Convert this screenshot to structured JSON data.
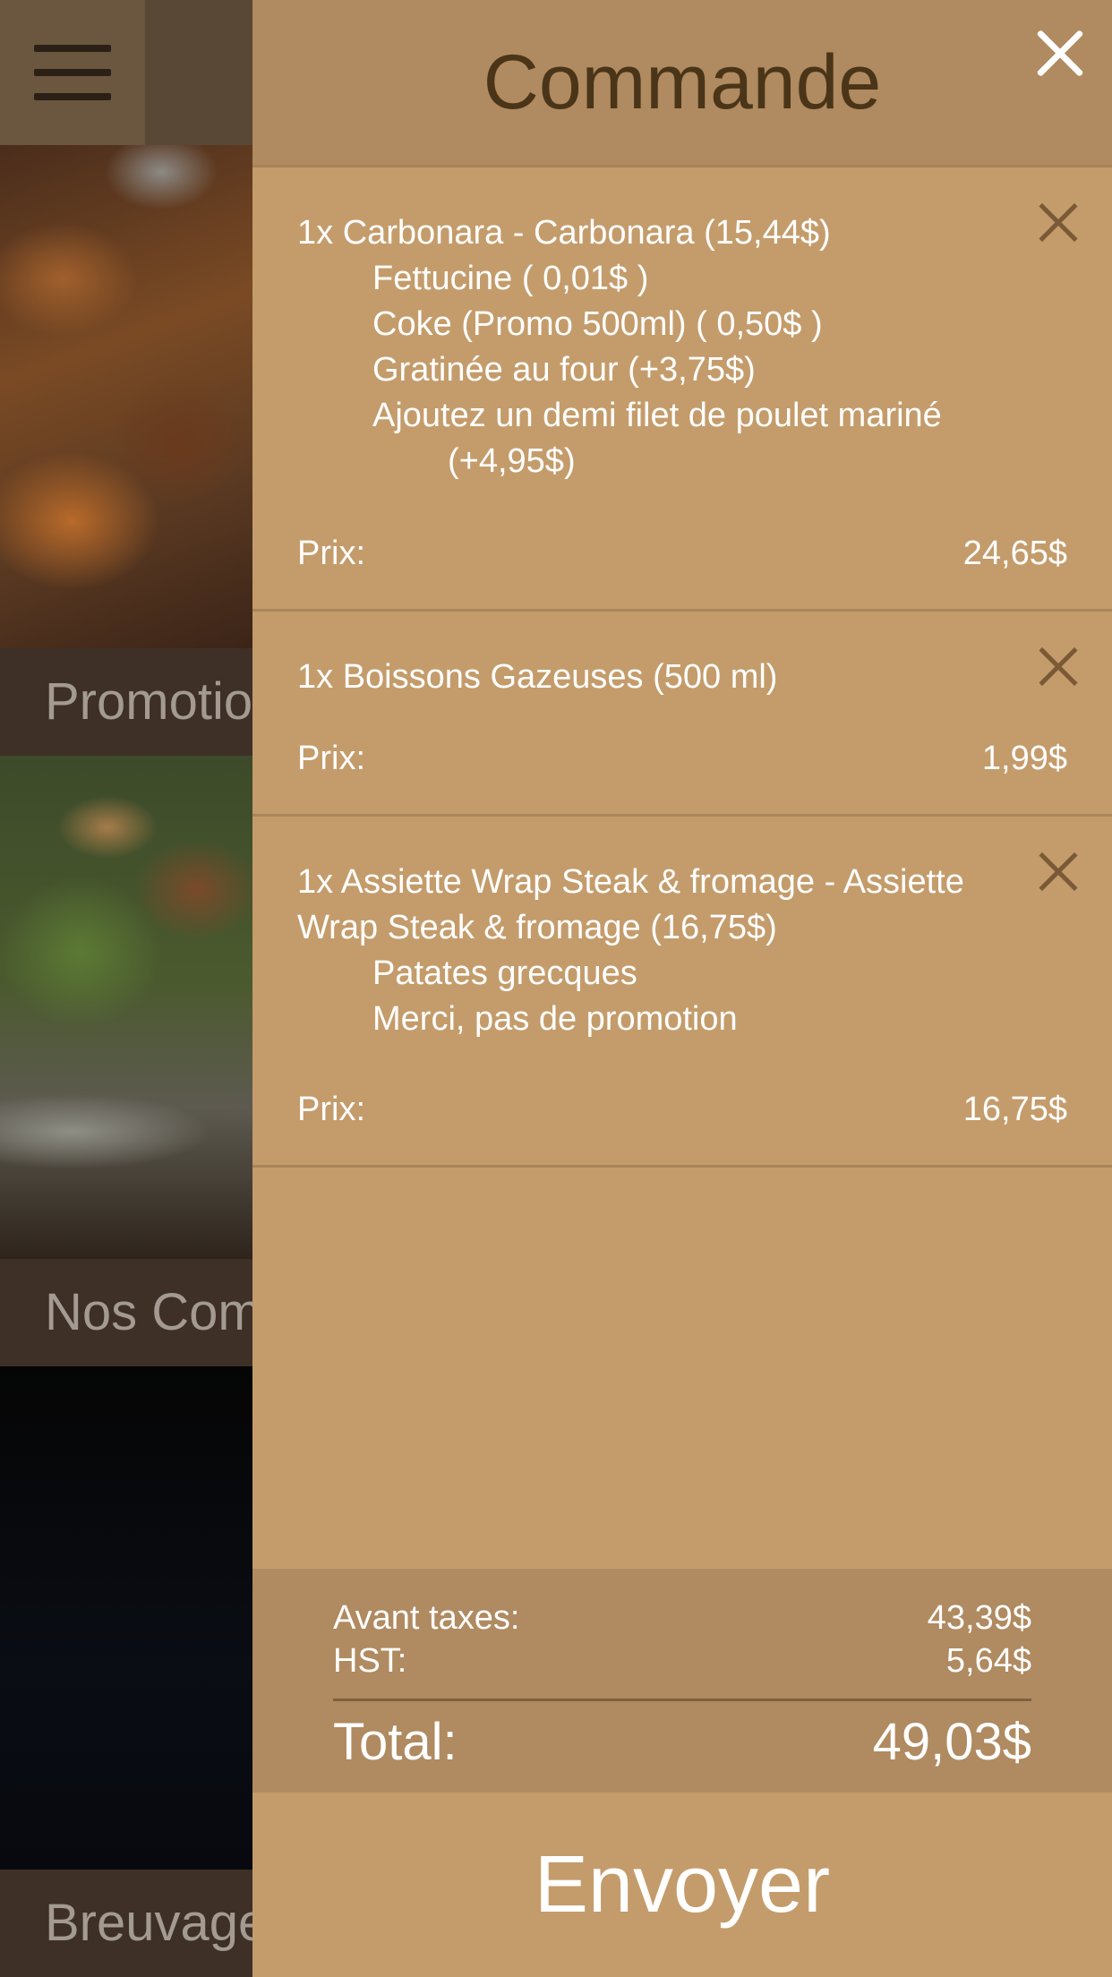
{
  "background": {
    "categories": [
      {
        "label": "Promotions"
      },
      {
        "label": "Nos Combos"
      },
      {
        "label": "Breuvages"
      }
    ]
  },
  "drawer": {
    "title": "Commande",
    "orders": [
      {
        "title": "1x Carbonara - Carbonara (15,44$)",
        "options": [
          "Fettucine ( 0,01$ )",
          "Coke (Promo 500ml) ( 0,50$ )",
          "Gratinée au four (+3,75$)",
          "Ajoutez un demi filet de poulet mariné"
        ],
        "option_continuation": "(+4,95$)",
        "price_label": "Prix:",
        "price": "24,65$"
      },
      {
        "title": "1x Boissons Gazeuses (500 ml)",
        "price_label": "Prix:",
        "price": "1,99$"
      },
      {
        "title": "1x Assiette Wrap Steak & fromage - Assiette Wrap Steak & fromage (16,75$)",
        "options": [
          "Patates grecques",
          "Merci, pas de promotion"
        ],
        "price_label": "Prix:",
        "price": "16,75$"
      }
    ],
    "totals": {
      "subtotal_label": "Avant taxes:",
      "subtotal": "43,39$",
      "tax_label": "HST:",
      "tax": "5,64$",
      "total_label": "Total:",
      "total": "49,03$"
    },
    "send_label": "Envoyer"
  }
}
